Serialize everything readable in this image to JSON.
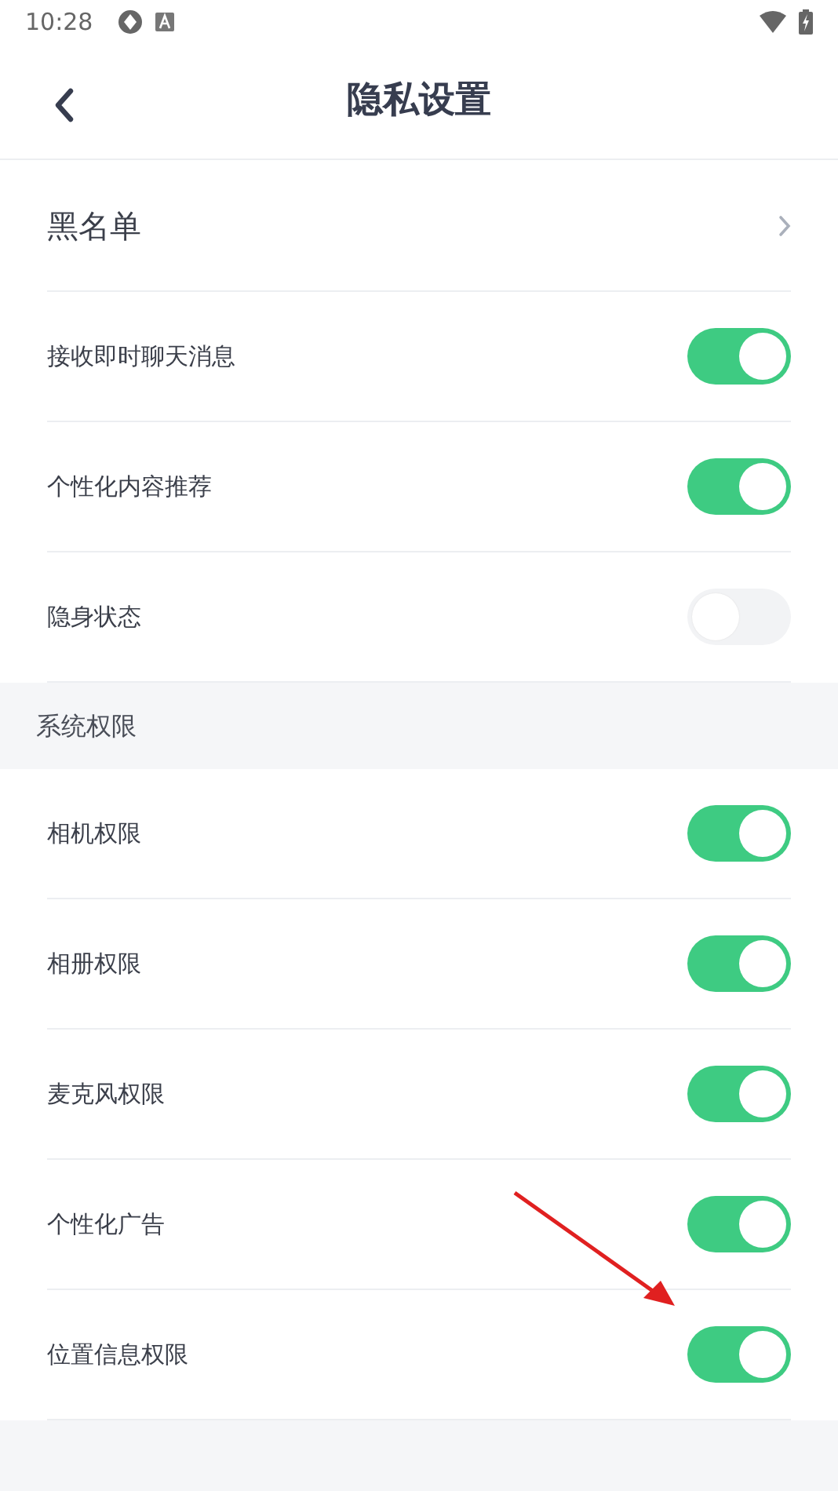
{
  "status_bar": {
    "time": "10:28"
  },
  "header": {
    "title": "隐私设置"
  },
  "groups": [
    {
      "items": [
        {
          "kind": "link",
          "label": "黑名单"
        },
        {
          "kind": "toggle",
          "label": "接收即时聊天消息",
          "on": true
        },
        {
          "kind": "toggle",
          "label": "个性化内容推荐",
          "on": true
        },
        {
          "kind": "toggle",
          "label": "隐身状态",
          "on": false
        }
      ]
    },
    {
      "heading": "系统权限",
      "items": [
        {
          "kind": "toggle",
          "label": "相机权限",
          "on": true
        },
        {
          "kind": "toggle",
          "label": "相册权限",
          "on": true
        },
        {
          "kind": "toggle",
          "label": "麦克风权限",
          "on": true
        },
        {
          "kind": "toggle",
          "label": "个性化广告",
          "on": true
        },
        {
          "kind": "toggle",
          "label": "位置信息权限",
          "on": true
        }
      ]
    }
  ]
}
